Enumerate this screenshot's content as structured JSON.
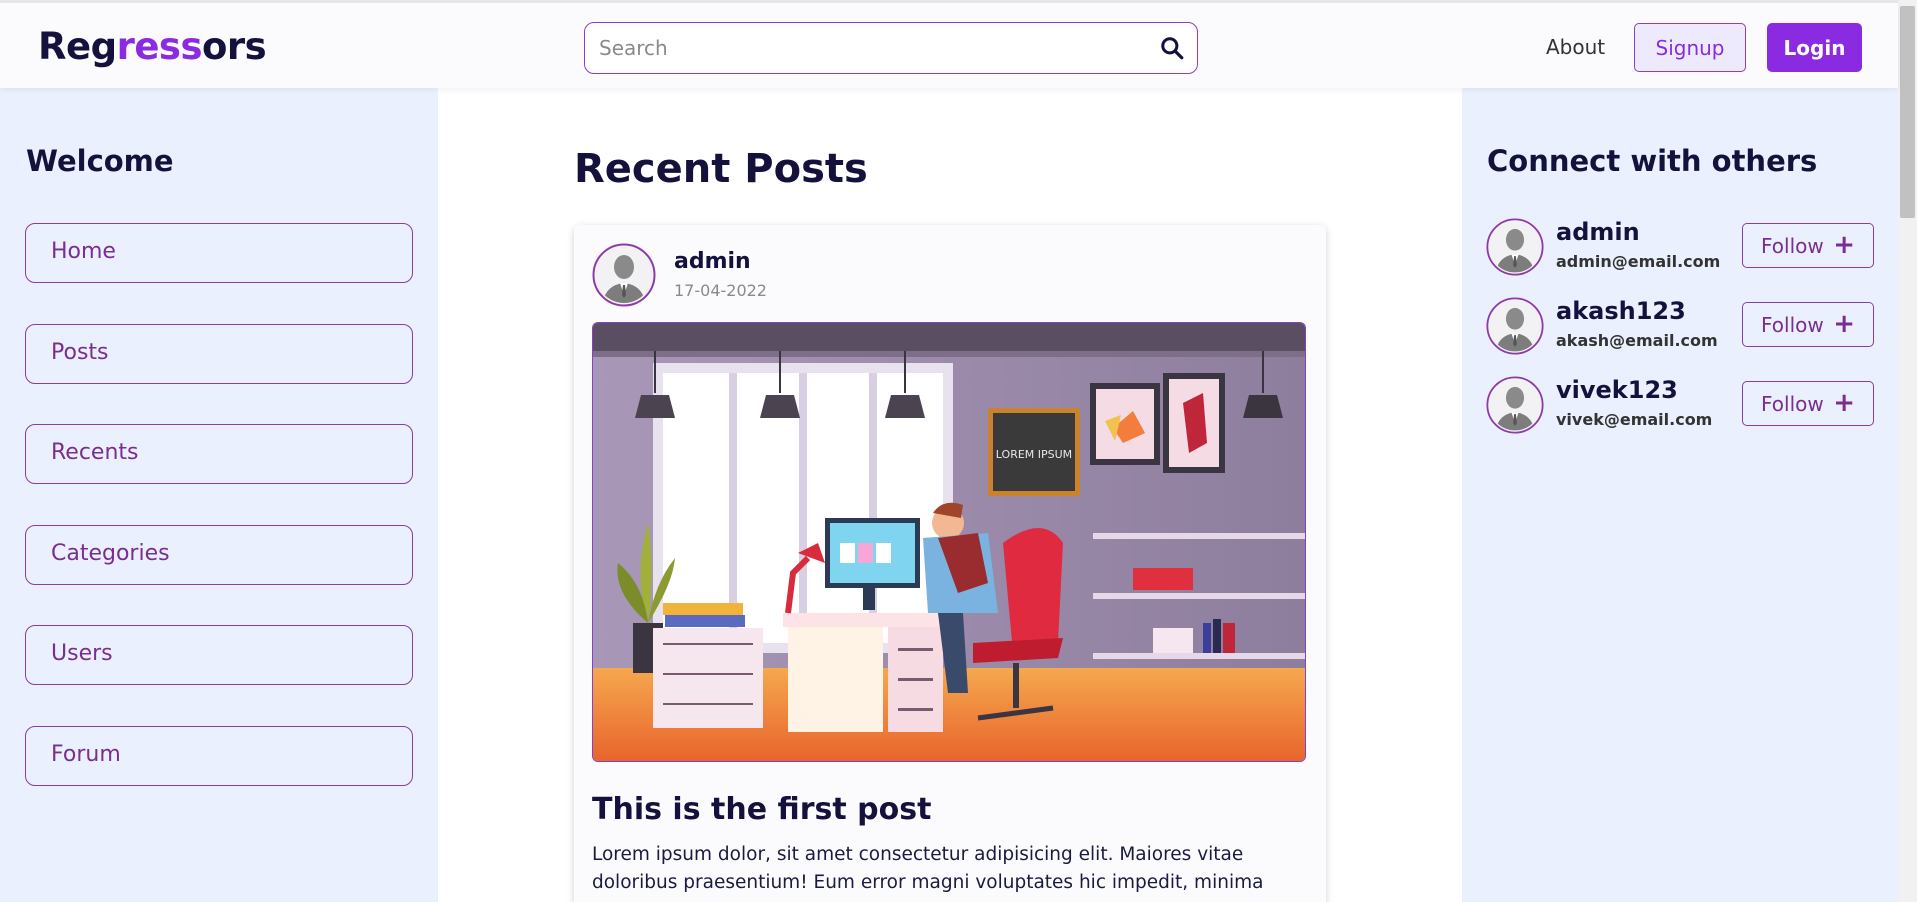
{
  "header": {
    "logo": {
      "part1": "Reg",
      "part2": "ress",
      "part3": "ors"
    },
    "search_placeholder": "Search",
    "about_label": "About",
    "signup_label": "Signup",
    "login_label": "Login"
  },
  "sidebar": {
    "title": "Welcome",
    "items": [
      {
        "label": "Home"
      },
      {
        "label": "Posts"
      },
      {
        "label": "Recents"
      },
      {
        "label": "Categories"
      },
      {
        "label": "Users"
      },
      {
        "label": "Forum"
      }
    ]
  },
  "main": {
    "title": "Recent Posts",
    "posts": [
      {
        "author": "admin",
        "date": "17-04-2022",
        "image_text": "LOREM IPSUM",
        "title": "This is the first post",
        "excerpt": "Lorem ipsum dolor, sit amet consectetur adipisicing elit. Maiores vitae doloribus praesentium! Eum error magni voluptates hic impedit, minima"
      }
    ]
  },
  "connect": {
    "title": "Connect with others",
    "follow_label": "Follow",
    "follow_icon": "+",
    "users": [
      {
        "name": "admin",
        "email": "admin@email.com"
      },
      {
        "name": "akash123",
        "email": "akash@email.com"
      },
      {
        "name": "vivek123",
        "email": "vivek@email.com"
      }
    ]
  },
  "colors": {
    "accent": "#8a2be2",
    "dark": "#14123d",
    "sidebar_bg": "#eaf0fd"
  }
}
